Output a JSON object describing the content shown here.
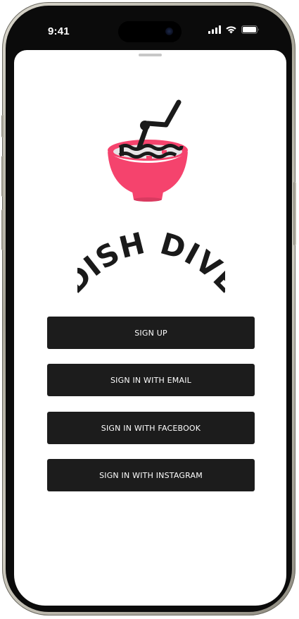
{
  "status_bar": {
    "time": "9:41",
    "icons": [
      "cellular-signal-icon",
      "wifi-icon",
      "battery-icon"
    ]
  },
  "app": {
    "logo_text": "DISH DIVE",
    "logo_icon": "bowl-diver-icon"
  },
  "buttons": {
    "sign_up": "SIGN UP",
    "sign_in_email": "SIGN IN WITH EMAIL",
    "sign_in_facebook": "SIGN IN WITH FACEBOOK",
    "sign_in_instagram": "SIGN IN WITH INSTAGRAM"
  },
  "colors": {
    "button_bg": "#1c1c1c",
    "button_text": "#ffffff",
    "bowl": "#f5436d",
    "ink": "#1a1a1a",
    "sheet_bg": "#ffffff",
    "frame": "#0b0b0b"
  }
}
